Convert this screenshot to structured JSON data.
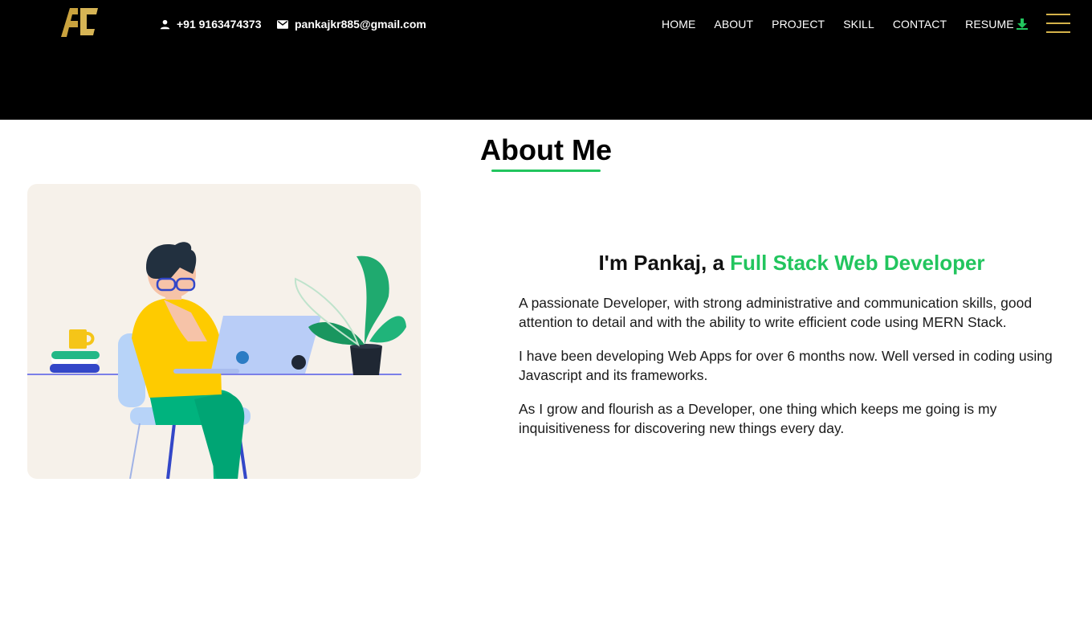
{
  "header": {
    "logo_alt": "AC",
    "phone": "+91 9163474373",
    "email": "pankajkr885@gmail.com",
    "nav": [
      "HOME",
      "ABOUT",
      "PROJECT",
      "SKILL",
      "CONTACT"
    ],
    "resume_label": "RESUME",
    "menu_icon": "hamburger-menu-icon"
  },
  "about": {
    "title": "About Me",
    "intro_prefix": "I'm Pankaj, a ",
    "intro_role": "Full Stack Web Developer",
    "paragraphs": [
      "A passionate Developer, with strong administrative and communication skills, good attention to detail and with the ability to write efficient code using MERN Stack.",
      "I have been developing Web Apps for over 6 months now. Well versed in coding using Javascript and its frameworks.",
      "As I grow and flourish as a Developer, one thing which keeps me going is my inquisitiveness for discovering new things every day."
    ]
  },
  "colors": {
    "accent": "#22c55e",
    "gold": "#d4b24a",
    "header_bg": "#000000"
  }
}
